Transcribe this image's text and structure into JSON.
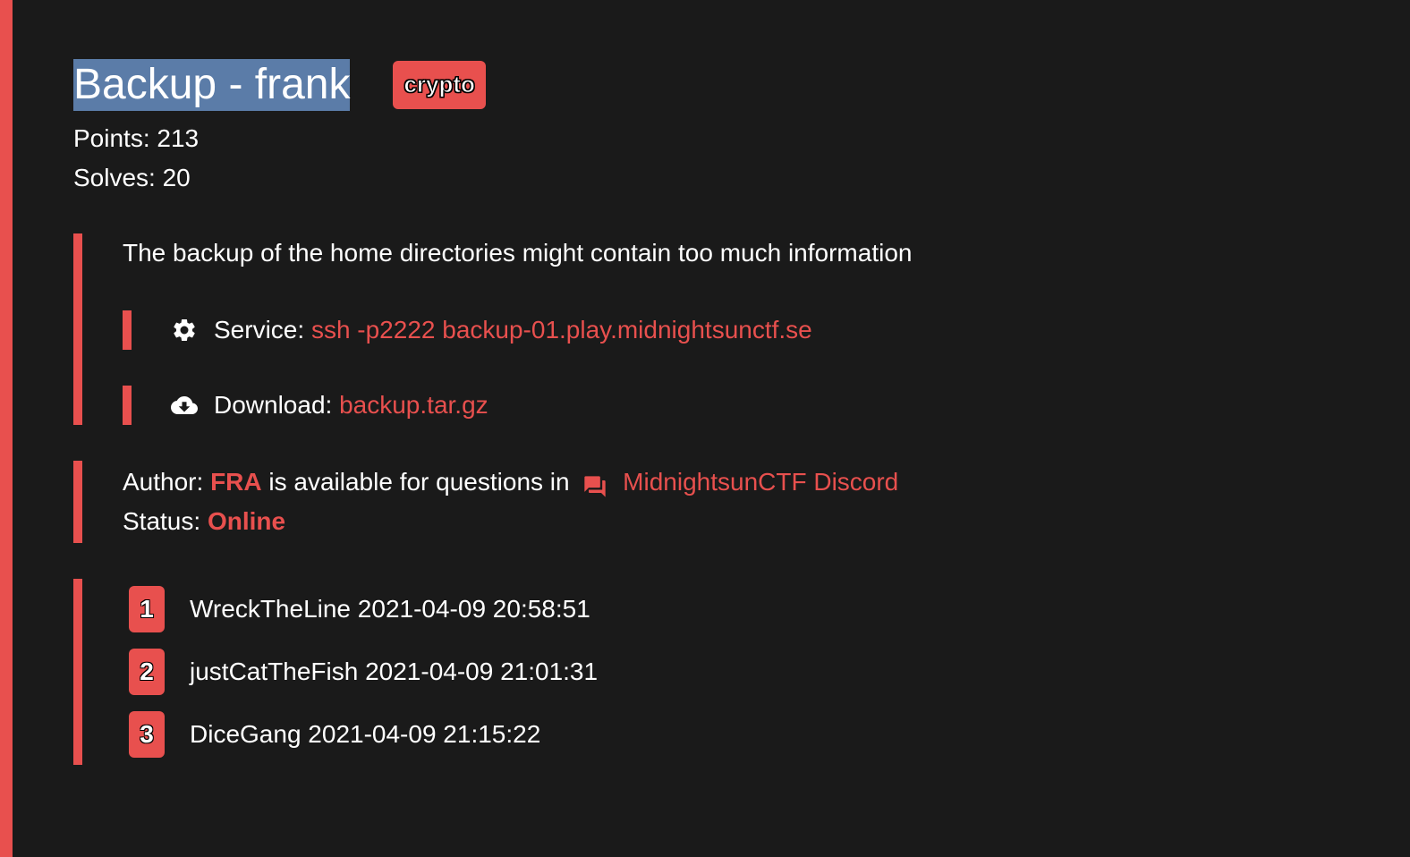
{
  "challenge": {
    "title": "Backup - frank",
    "category": "crypto",
    "points_label": "Points:",
    "points": "213",
    "solves_label": "Solves:",
    "solves": "20",
    "description": "The backup of the home directories might contain too much information",
    "service_label": "Service:",
    "service_value": "ssh -p2222 backup-01.play.midnightsunctf.se",
    "download_label": "Download:",
    "download_value": "backup.tar.gz",
    "author_label": "Author:",
    "author_name": "FRA",
    "author_middle": "is available for questions in",
    "discord_label": "MidnightsunCTF Discord",
    "status_label": "Status:",
    "status_value": "Online",
    "solvers": [
      {
        "rank": "1",
        "team": "WreckTheLine",
        "time": "2021-04-09 20:58:51"
      },
      {
        "rank": "2",
        "team": "justCatTheFish",
        "time": "2021-04-09 21:01:31"
      },
      {
        "rank": "3",
        "team": "DiceGang",
        "time": "2021-04-09 21:15:22"
      }
    ]
  },
  "colors": {
    "accent": "#e8504e",
    "background": "#1a1a1a",
    "selection": "#5b7ca8",
    "text": "#ffffff"
  },
  "icons": {
    "service": "gear-icon",
    "download": "cloud-download-icon",
    "discord": "chat-bubbles-icon"
  }
}
